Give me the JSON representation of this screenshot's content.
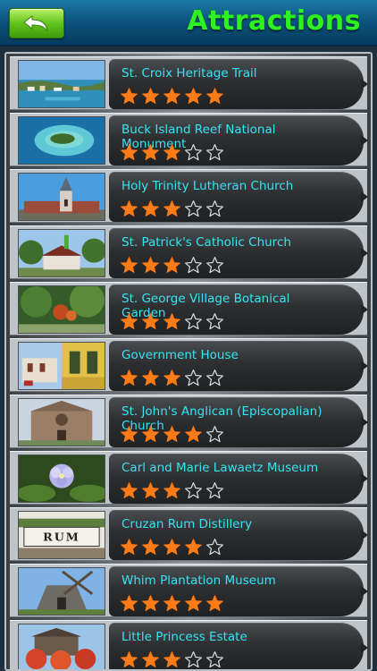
{
  "header": {
    "title": "Attractions",
    "back_icon": "back-arrow-icon"
  },
  "attractions": [
    {
      "name": "St. Croix Heritage Trail",
      "rating": 5
    },
    {
      "name": "Buck Island Reef National Monument",
      "rating": 3
    },
    {
      "name": "Holy Trinity Lutheran Church",
      "rating": 3
    },
    {
      "name": "St. Patrick's Catholic Church",
      "rating": 3
    },
    {
      "name": "St. George Village Botanical Garden",
      "rating": 3
    },
    {
      "name": "Government House",
      "rating": 3
    },
    {
      "name": "St. John's Anglican (Episcopalian) Church",
      "rating": 4
    },
    {
      "name": "Carl and Marie Lawaetz Museum",
      "rating": 3
    },
    {
      "name": "Cruzan Rum Distillery",
      "rating": 4
    },
    {
      "name": "Whim Plantation Museum",
      "rating": 5
    },
    {
      "name": "Little Princess Estate",
      "rating": 3
    }
  ],
  "rating_max": 5,
  "colors": {
    "title": "#2ef21e",
    "name_text": "#36e4f2",
    "star_filled": "#ff7b16",
    "back_button": "#62c41d"
  }
}
